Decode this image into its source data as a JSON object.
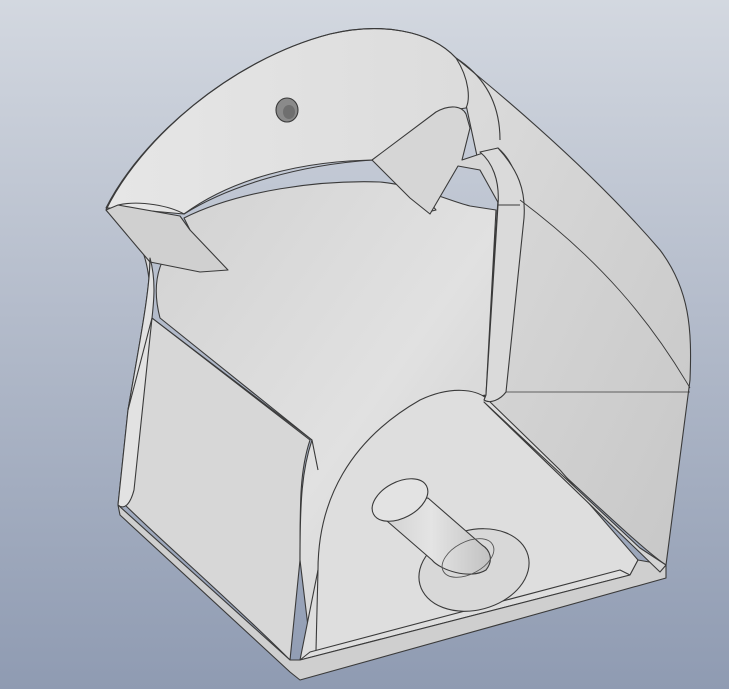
{
  "viewport": {
    "background_top": "#d3d8e0",
    "background_bottom": "#8f9bb2"
  },
  "model": {
    "body_color": "#d9d9d9",
    "face_light": "#e6e6e6",
    "face_shadow": "#c8c8c8",
    "edge_color": "#3a3a3a"
  }
}
